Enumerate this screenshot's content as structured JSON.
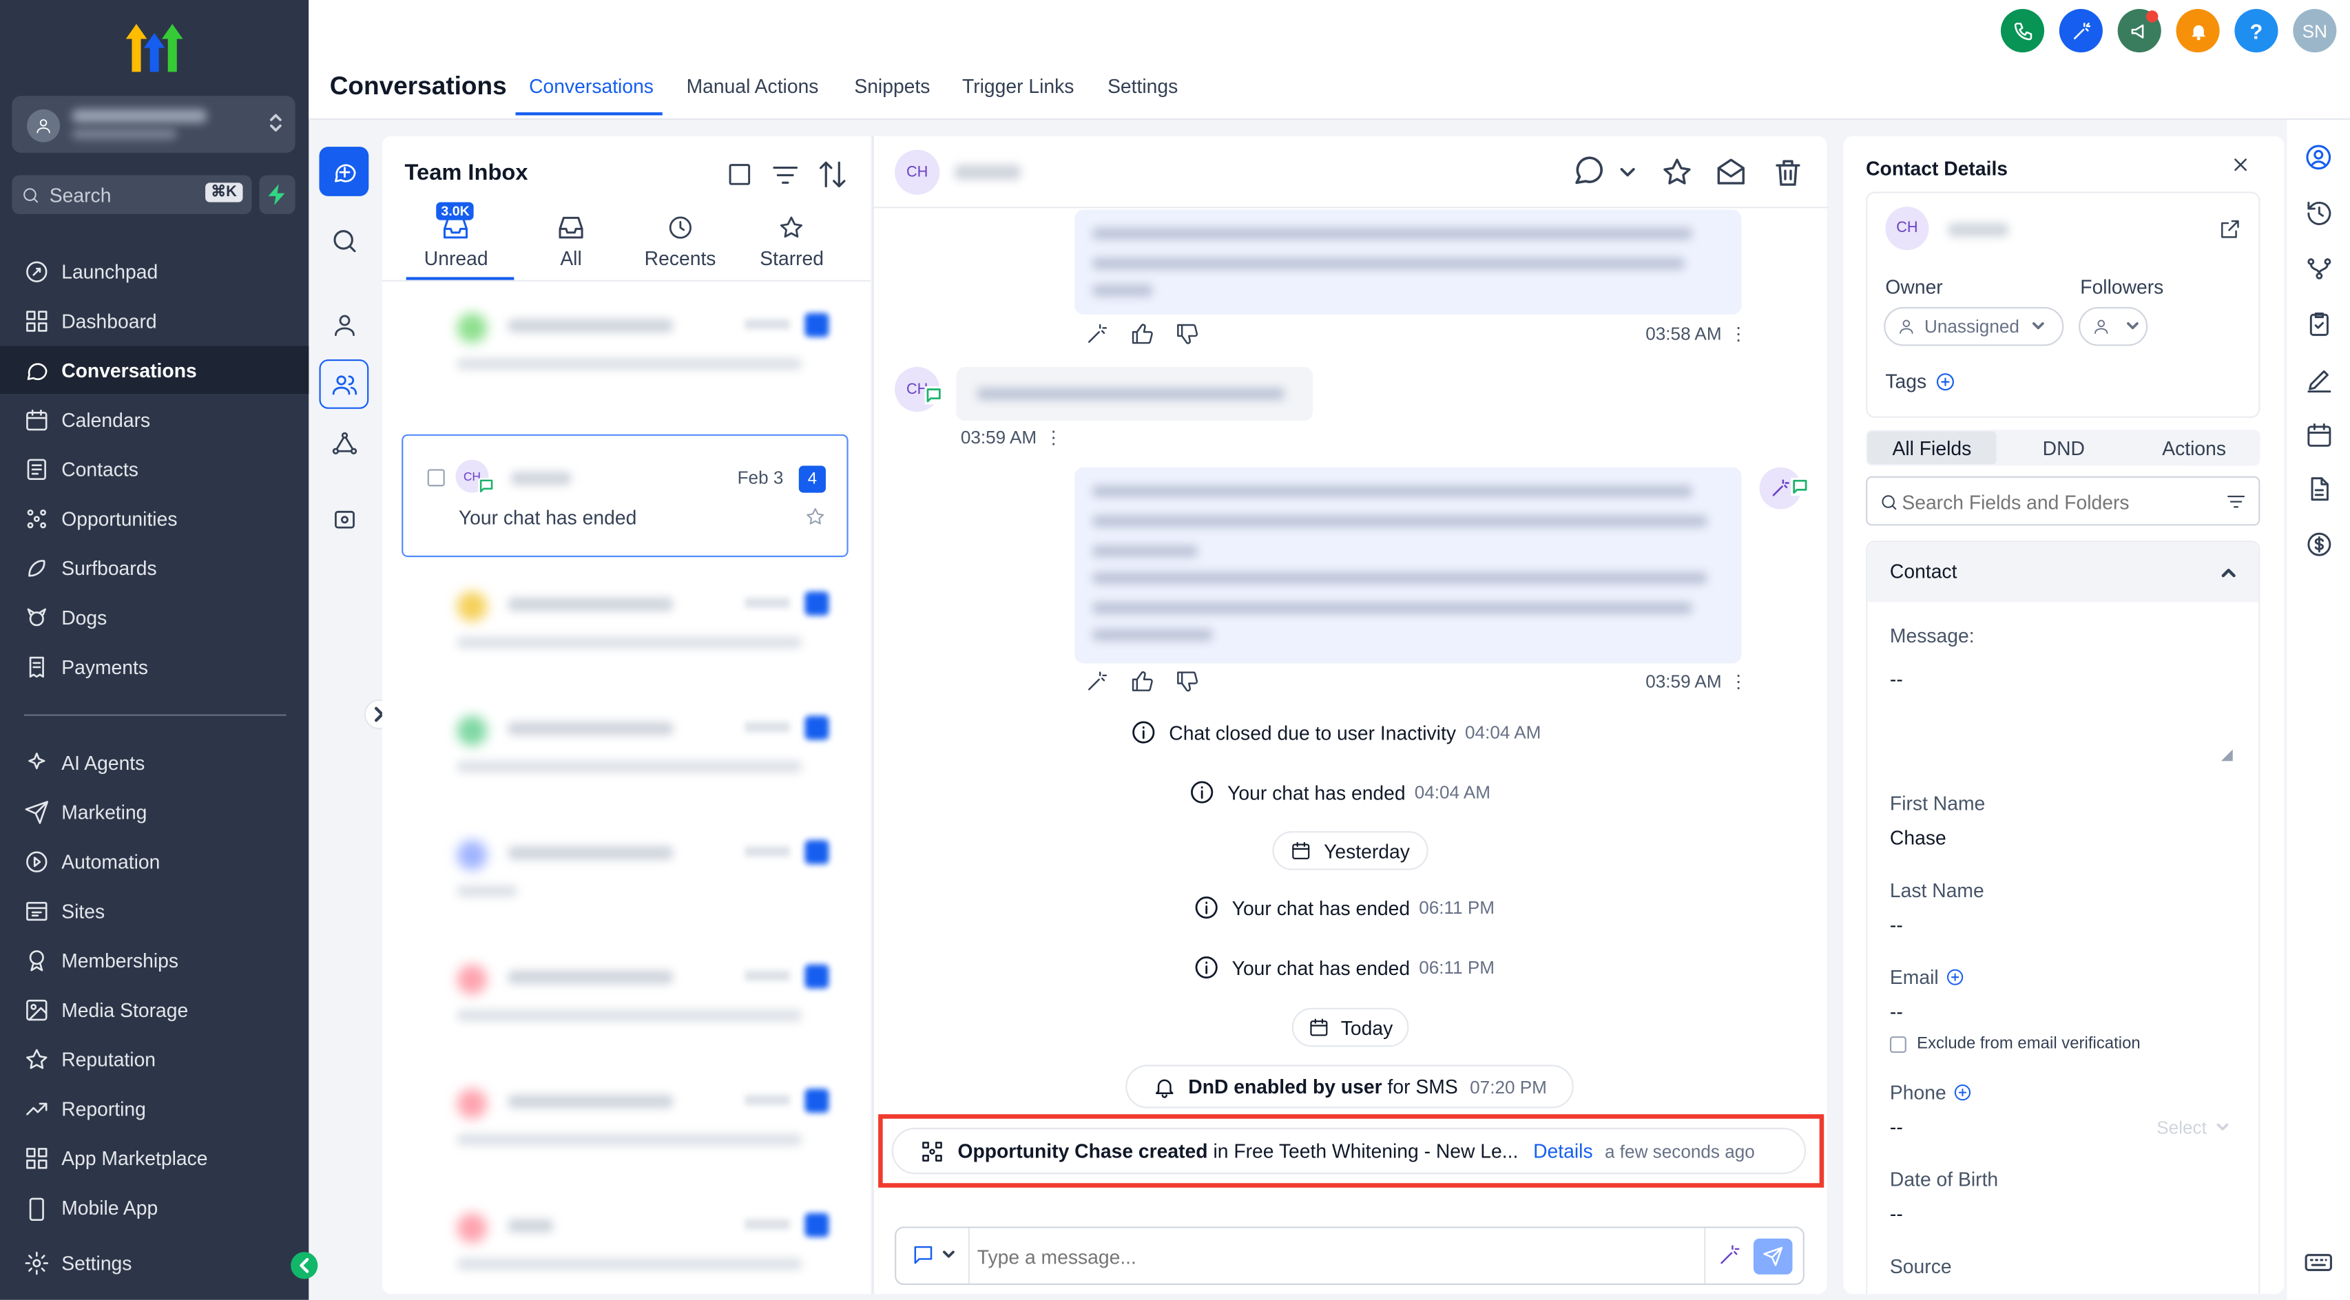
{
  "sidebar": {
    "search_placeholder": "Search",
    "search_kbd": "⌘K",
    "items": [
      {
        "label": "Launchpad"
      },
      {
        "label": "Dashboard"
      },
      {
        "label": "Conversations"
      },
      {
        "label": "Calendars"
      },
      {
        "label": "Contacts"
      },
      {
        "label": "Opportunities"
      },
      {
        "label": "Surfboards"
      },
      {
        "label": "Dogs"
      },
      {
        "label": "Payments"
      }
    ],
    "items2": [
      {
        "label": "AI Agents"
      },
      {
        "label": "Marketing"
      },
      {
        "label": "Automation"
      },
      {
        "label": "Sites"
      },
      {
        "label": "Memberships"
      },
      {
        "label": "Media Storage"
      },
      {
        "label": "Reputation"
      },
      {
        "label": "Reporting"
      },
      {
        "label": "App Marketplace"
      },
      {
        "label": "Mobile App"
      }
    ],
    "settings_label": "Settings"
  },
  "header": {
    "title": "Conversations",
    "tabs": [
      {
        "label": "Conversations"
      },
      {
        "label": "Manual Actions"
      },
      {
        "label": "Snippets"
      },
      {
        "label": "Trigger Links"
      },
      {
        "label": "Settings"
      }
    ],
    "user_initials": "SN",
    "help": "?"
  },
  "inbox": {
    "title": "Team Inbox",
    "tabs": [
      {
        "label": "Unread",
        "badge": "3.0K"
      },
      {
        "label": "All"
      },
      {
        "label": "Recents"
      },
      {
        "label": "Starred"
      }
    ],
    "selected": {
      "initials": "CH",
      "date": "Feb 3",
      "badge": "4",
      "preview": "Your chat has ended"
    }
  },
  "chat": {
    "initials": "CH",
    "times": {
      "t1": "03:58 AM",
      "t2": "03:59 AM",
      "t3": "03:59 AM"
    },
    "events": [
      {
        "text": "Chat closed due to user Inactivity",
        "time": "04:04 AM"
      },
      {
        "text": "Your chat has ended",
        "time": "04:04 AM"
      },
      {
        "text": "Your chat has ended",
        "time": "06:11 PM"
      },
      {
        "text": "Your chat has ended",
        "time": "06:11 PM"
      }
    ],
    "day_yesterday": "Yesterday",
    "day_today": "Today",
    "dnd": {
      "bold": "DnD enabled by user",
      "rest": "for SMS",
      "time": "07:20 PM"
    },
    "opportunity": {
      "bold": "Opportunity Chase created",
      "rest": "in Free Teeth Whitening - New Le...",
      "link": "Details",
      "time": "a few seconds ago"
    },
    "composer_placeholder": "Type a message..."
  },
  "contact": {
    "title": "Contact Details",
    "initials": "CH",
    "owner_label": "Owner",
    "owner_value": "Unassigned",
    "followers_label": "Followers",
    "tags_label": "Tags",
    "tabs": [
      {
        "label": "All Fields"
      },
      {
        "label": "DND"
      },
      {
        "label": "Actions"
      }
    ],
    "search_placeholder": "Search Fields and Folders",
    "section": "Contact",
    "message_label": "Message:",
    "message_value": "--",
    "first_name_label": "First Name",
    "first_name_value": "Chase",
    "last_name_label": "Last Name",
    "last_name_value": "--",
    "email_label": "Email",
    "email_value": "--",
    "exclude_label": "Exclude from email verification",
    "phone_label": "Phone",
    "phone_value": "--",
    "phone_select": "Select",
    "dob_label": "Date of Birth",
    "dob_value": "--",
    "source_label": "Source"
  },
  "colors": {
    "accent": "#155eef",
    "sidebar": "#2d3648",
    "highlight": "#f03a2e"
  }
}
